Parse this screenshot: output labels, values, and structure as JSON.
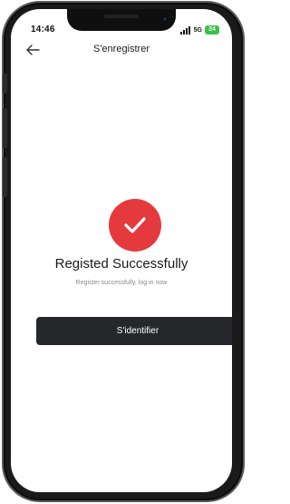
{
  "status_bar": {
    "time": "14:46",
    "network": "5G",
    "battery": "24"
  },
  "nav": {
    "title": "S'enregistrer",
    "back_icon": "arrow-left-icon"
  },
  "success": {
    "icon": "check-icon",
    "heading": "Registed Successfully",
    "subtext": "Register successfully, log in now"
  },
  "login_button": {
    "label": "S'identifier"
  },
  "colors": {
    "accent_red": "#e53a3d",
    "button_bg": "#26272b",
    "battery_green": "#39c14a"
  }
}
